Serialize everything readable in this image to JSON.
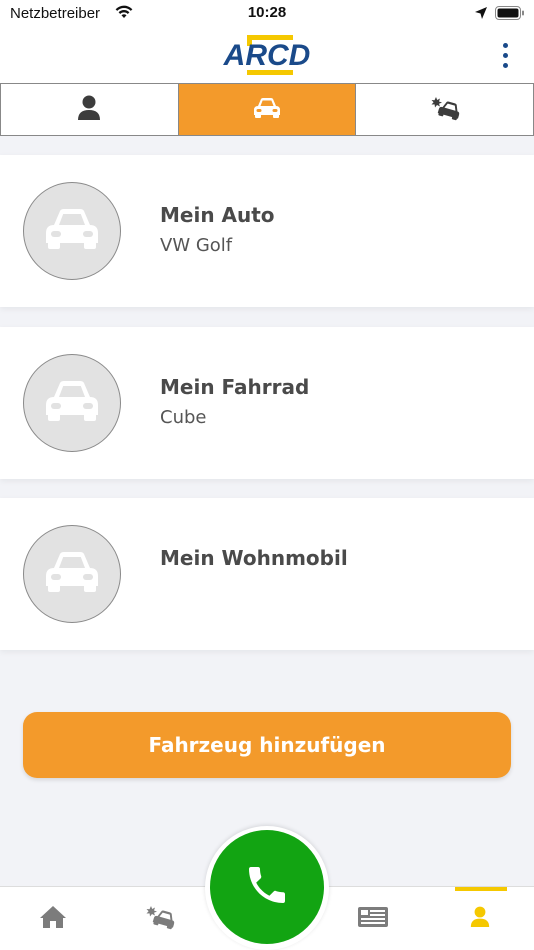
{
  "status_bar": {
    "carrier": "Netzbetreiber",
    "time": "10:28"
  },
  "header": {
    "logo_text": "ARCD",
    "brand_color": "#1a4a8a",
    "accent_color": "#f5c800"
  },
  "tabs": [
    {
      "icon": "person-icon",
      "active": false
    },
    {
      "icon": "car-icon",
      "active": true
    },
    {
      "icon": "car-crash-icon",
      "active": false
    }
  ],
  "vehicles": [
    {
      "title": "Mein Auto",
      "subtitle": "VW Golf"
    },
    {
      "title": "Mein Fahrrad",
      "subtitle": "Cube"
    },
    {
      "title": "Mein Wohnmobil",
      "subtitle": ""
    }
  ],
  "add_button_label": "Fahrzeug hinzufügen",
  "bottom_nav": [
    {
      "icon": "home-icon"
    },
    {
      "icon": "car-crash-icon"
    },
    {
      "icon": "phone-icon"
    },
    {
      "icon": "news-icon"
    },
    {
      "icon": "person-icon",
      "active": true
    }
  ],
  "colors": {
    "orange": "#f39a2b",
    "green": "#12a412",
    "yellow": "#f5c800",
    "blue": "#1a4a8a"
  }
}
